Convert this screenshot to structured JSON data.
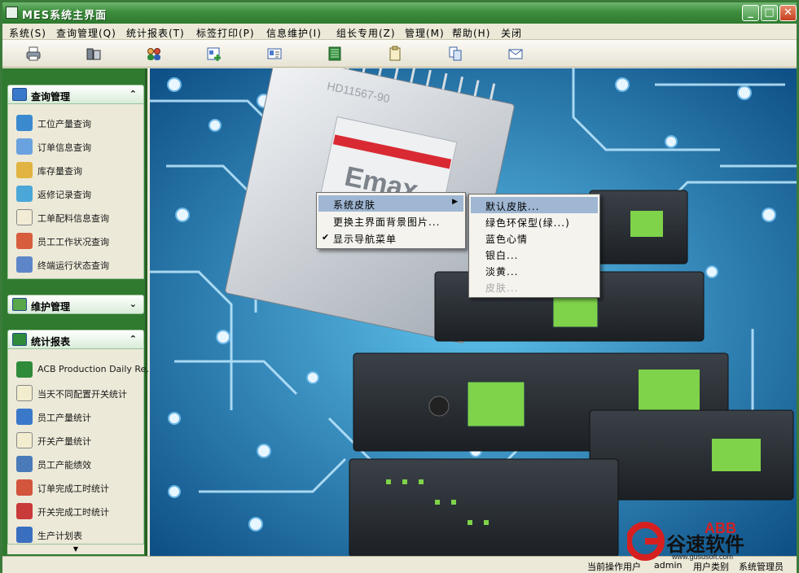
{
  "window": {
    "title": "MES系统主界面"
  },
  "menubar": [
    "系统(S)",
    "查询管理(Q)",
    "统计报表(T)",
    "标签打印(P)",
    "信息维护(I)",
    "组长专用(Z)",
    "管理(M)",
    "帮助(H)",
    "关闭"
  ],
  "toolbar": [
    "printer-icon",
    "database-icon",
    "users-icon",
    "add-record-icon",
    "id-card-icon",
    "list-icon",
    "clipboard-icon",
    "copy-icon",
    "mail-icon"
  ],
  "sidebar": {
    "query": {
      "title": "查询管理",
      "items": [
        "工位产量查询",
        "订单信息查询",
        "库存量查询",
        "返修记录查询",
        "工单配料信息查询",
        "员工工作状况查询",
        "终端运行状态查询"
      ]
    },
    "maintenance": {
      "title": "维护管理"
    },
    "reports": {
      "title": "统计报表",
      "items": [
        "ACB Production Daily Re...",
        "当天不同配置开关统计",
        "员工产量统计",
        "开关产量统计",
        "员工产能绩效",
        "订单完成工时统计",
        "开关完成工时统计",
        "生产计划表"
      ]
    }
  },
  "context_menu": {
    "items": [
      "系统皮肤",
      "更换主界面背景图片...",
      "显示导航菜单"
    ],
    "submenu": [
      "默认皮肤...",
      "绿色环保型(绿...)",
      "蓝色心情",
      "银白...",
      "淡黄...",
      "皮肤..."
    ]
  },
  "background": {
    "chip_model": "HD11567-90",
    "chip_brand": "Emax"
  },
  "statusbar": {
    "user_label": "当前操作用户",
    "user_value": "admin",
    "role": "用户类别",
    "role_value": "系统管理员"
  },
  "watermark": {
    "brand": "ABB",
    "site": "谷速软件",
    "url": "www.gususoft.com"
  }
}
